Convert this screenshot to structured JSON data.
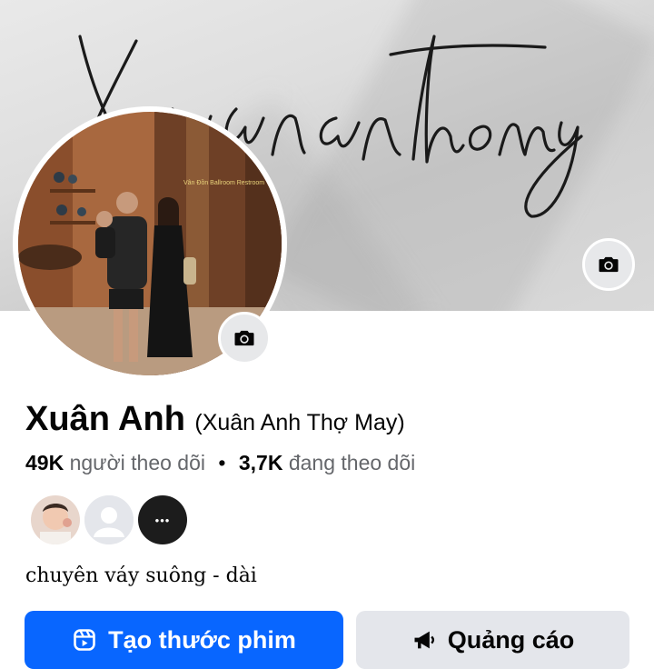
{
  "cover": {
    "signature_text": "Xuananhthomay",
    "camera_icon": "camera-icon"
  },
  "profile_photo": {
    "sign_text": "Vân Đồn Ballroom Restroom",
    "camera_icon": "camera-icon"
  },
  "profile": {
    "name": "Xuân Anh",
    "alt_name": "(Xuân Anh Thợ May)",
    "followers_count": "49K",
    "followers_label": "người theo dõi",
    "separator": "•",
    "following_count": "3,7K",
    "following_label": "đang theo dõi",
    "bio": "chuyên váy suông - dài"
  },
  "friends": {
    "more_label": "•••"
  },
  "buttons": {
    "create_reel": "Tạo thước phim",
    "ads": "Quảng cáo"
  },
  "colors": {
    "primary_button": "#0866ff",
    "secondary_button": "#e4e6eb",
    "muted_text": "#65676b"
  }
}
